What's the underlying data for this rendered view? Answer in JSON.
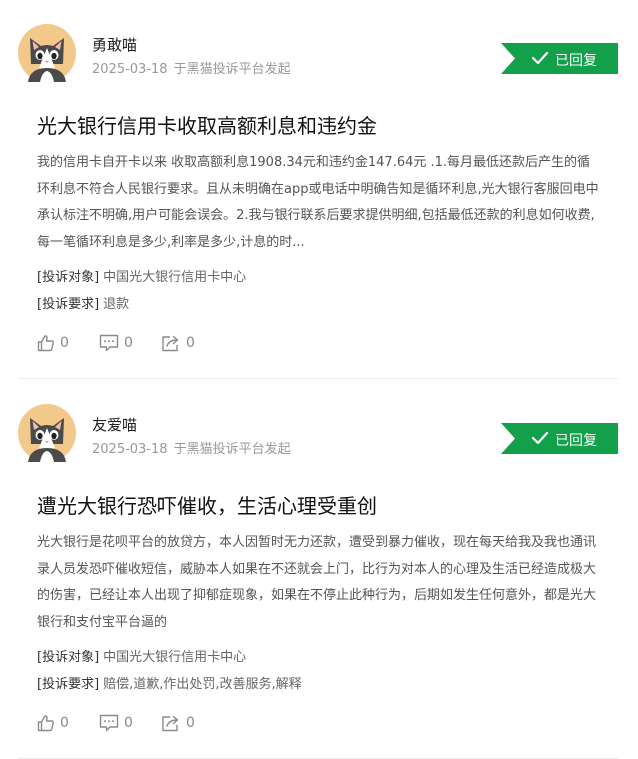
{
  "colors": {
    "accent_green": "#12a04a",
    "title": "#111111",
    "muted": "#999999"
  },
  "posts": [
    {
      "username": "勇敢喵",
      "date": "2025-03-18",
      "source": "于黑猫投诉平台发起",
      "status": "已回复",
      "title": "光大银行信用卡收取高额利息和违约金",
      "body": "我的信用卡自开卡以来 收取高额利息1908.34元和违约金147.64元 .1.每月最低还款后产生的循环利息不符合人民银行要求。且从未明确在app或电话中明确告知是循环利息,光大银行客服回电中承认标注不明确,用户可能会误会。2.我与银行联系后要求提供明细,包括最低还款的利息如何收费,每一笔循环利息是多少,利率是多少,计息的时...",
      "target_label": "[投诉对象]",
      "target_value": "中国光大银行信用卡中心",
      "demand_label": "[投诉要求]",
      "demand_value": "退款",
      "likes": "0",
      "comments": "0",
      "shares": "0"
    },
    {
      "username": "友爱喵",
      "date": "2025-03-18",
      "source": "于黑猫投诉平台发起",
      "status": "已回复",
      "title": "遭光大银行恐吓催收，生活心理受重创",
      "body": "光大银行是花呗平台的放贷方，本人因暂时无力还款，遭受到暴力催收，现在每天给我及我也通讯录人员发恐吓催收短信，威胁本人如果在不还就会上门，比行为对本人的心理及生活已经造成极大的伤害，已经让本人出现了抑郁症现象，如果在不停止此种行为，后期如发生任何意外，都是光大银行和支付宝平台逼的",
      "target_label": "[投诉对象]",
      "target_value": "中国光大银行信用卡中心",
      "demand_label": "[投诉要求]",
      "demand_value": "赔偿,道歉,作出处罚,改善服务,解释",
      "likes": "0",
      "comments": "0",
      "shares": "0"
    }
  ]
}
